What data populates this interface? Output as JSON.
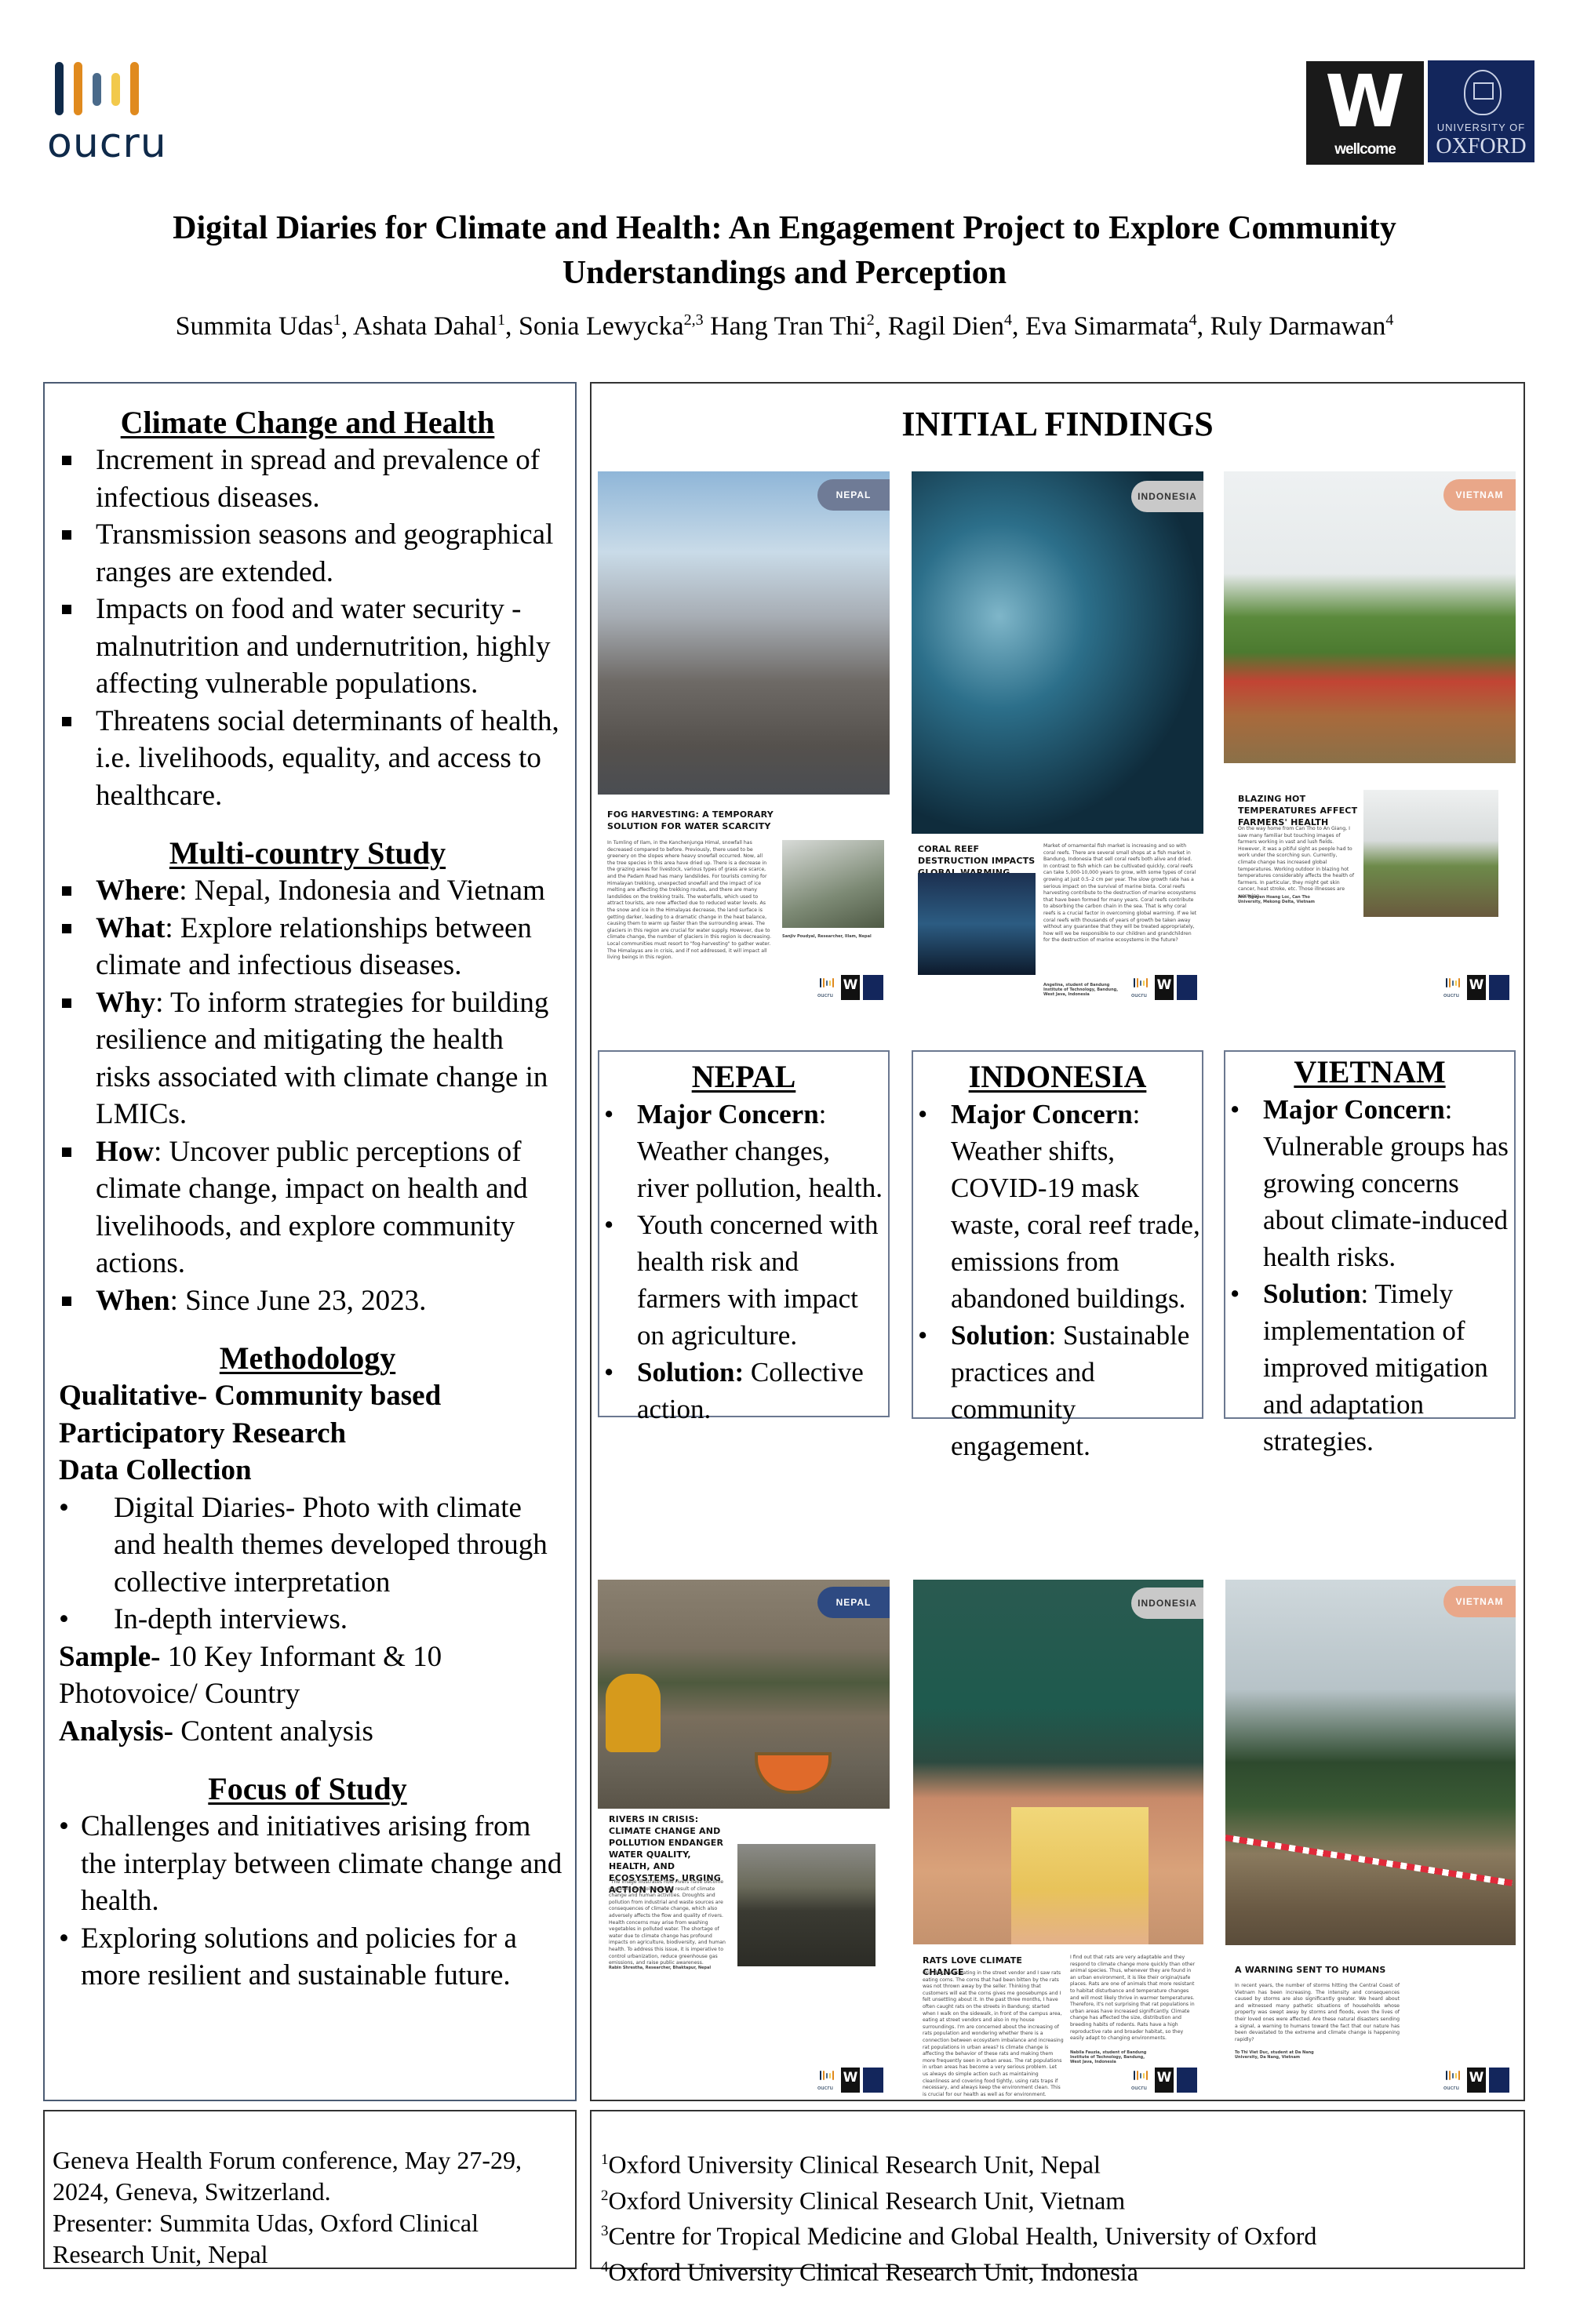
{
  "header": {
    "logos": {
      "oucru": {
        "text": "oucru",
        "bar_colors": [
          "#0f2a4a",
          "#e08a1e",
          "#4a6a8a",
          "#f2c94c",
          "#e08a1e"
        ]
      },
      "wellcome": {
        "mark": "W",
        "text": "wellcome",
        "bg": "#1a1a1a"
      },
      "oxford": {
        "small_text": "UNIVERSITY OF",
        "big_text": "OXFORD",
        "bg": "#13265c"
      }
    },
    "title_line1": "Digital Diaries for Climate and Health: An Engagement Project to Explore Community",
    "title_line2": "Understandings and Perception",
    "authors": [
      {
        "name": "Summita Udas",
        "sup": "1",
        "sep": ", "
      },
      {
        "name": "Ashata Dahal",
        "sup": "1",
        "sep": ", "
      },
      {
        "name": "Sonia Lewycka",
        "sup": "2,3",
        "sep": " "
      },
      {
        "name": "Hang Tran Thi",
        "sup": "2",
        "sep": ", "
      },
      {
        "name": "Ragil Dien",
        "sup": "4",
        "sep": ", "
      },
      {
        "name": "Eva Simarmata",
        "sup": "4",
        "sep": ", "
      },
      {
        "name": "Ruly Darmawan",
        "sup": "4",
        "sep": ""
      }
    ]
  },
  "left_panel": {
    "climate_health": {
      "title": "Climate Change and Health",
      "items": [
        "Increment in spread and prevalence of infectious diseases.",
        "Transmission seasons and geographical ranges are extended.",
        "Impacts on food and water security - malnutrition and undernutrition, highly affecting vulnerable populations.",
        "Threatens social determinants of health, i.e. livelihoods, equality, and access to healthcare."
      ]
    },
    "multi_country": {
      "title": "Multi-country Study",
      "items": [
        {
          "label": "Where",
          "text": ": Nepal, Indonesia and Vietnam"
        },
        {
          "label": "What",
          "text": ": Explore relationships between climate and infectious diseases."
        },
        {
          "label": "Why",
          "text": ": To inform strategies for building resilience and mitigating the health risks associated with climate change in LMICs."
        },
        {
          "label": "How",
          "text": ": Uncover public perceptions of climate change, impact on health and livelihoods, and explore community actions."
        },
        {
          "label": "When",
          "text": ": Since June 23, 2023."
        }
      ]
    },
    "methodology": {
      "title": "Methodology",
      "approach": "Qualitative- Community based Participatory Research",
      "data_collection_label": "Data Collection",
      "data_collection": [
        "Digital Diaries- Photo with climate and health themes developed through collective interpretation",
        "In-depth interviews."
      ],
      "sample_label": "Sample-",
      "sample_text": " 10 Key Informant & 10 Photovoice/ Country",
      "analysis_label": "Analysis-",
      "analysis_text": " Content analysis"
    },
    "focus": {
      "title": "Focus of Study",
      "items": [
        "Challenges and initiatives arising from the interplay between climate change and health.",
        "Exploring solutions and policies for a more resilient and sustainable future."
      ]
    }
  },
  "right_panel": {
    "title": "INITIAL FINDINGS",
    "tag_colors": {
      "nepal": "#6f7b96",
      "indonesia": "#c9c9c9",
      "vietnam": "#e9a789",
      "nepal_dark": "#2e4a82"
    },
    "top_cards": [
      {
        "country": "NEPAL",
        "heading": "Fog Harvesting: A Temporary Solution for Water Scarcity",
        "body": "In Tumling of Ilam, in the Kanchenjunga Himal, snowfall has decreased compared to before. Previously, there used to be greenery on the slopes where heavy snowfall occurred. Now, all the tree species in this area have dried up. There is a decrease in the grazing areas for livestock, various types of grass are scarce, and the Padam Road has many landslides. For tourists coming for Himalayan trekking, unexpected snowfall and the impact of ice melting are affecting the trekking routes, and there are many landslides on the trekking trails. The waterfalls, which used to attract tourists, are now affected due to reduced water levels. As the snow and ice in the Himalayas decrease, the land surface is getting darker, leading to a dramatic change in the heat balance, causing them to warm up faster than the surrounding areas. The glaciers in this region are crucial for water supply. However, due to climate change, the number of glaciers in this region is decreasing. Local communities must resort to \"fog-harvesting\" to gather water. The Himalayas are in crisis, and if not addressed, it will impact all living beings in this region.",
        "credit": "Sanjiv Poudyal, Researcher, Illam, Nepal"
      },
      {
        "country": "INDONESIA",
        "heading": "Coral Reef Destruction Impacts Global Warming",
        "body": "Market of ornamental fish market is increasing and so with coral reefs. There are several small shops at a fish market in Bandung, Indonesia that sell coral reefs both alive and dried. In contrast to fish which can be cultivated quickly, coral reefs can take 5,000-10,000 years to grow, with some types of coral growing at just 0.5–2 cm per year. The slow growth rate has a serious impact on the survival of marine biota. Coral reefs harvesting contribute to the destruction of marine ecosystems that have been formed for many years. Coral reefs contribute to absorbing the carbon chain in the sea. That is why coral reefs is a crucial factor in overcoming global warming. If we let coral reefs with thousands of years of growth be taken away without any guarantee that they will be treated appropriately, how will we be responsible to our children and grandchildren for the destruction of marine ecosystems in the future?",
        "credit": "Angelina, student of Bandung Institute of Technology, Bandung, West Java, Indonesia"
      },
      {
        "country": "VIETNAM",
        "heading": "Blazing Hot Temperatures Affect Farmers' Health",
        "body": "On the way home from Can Tho to An Giang, I saw many familiar but touching images of farmers working in vast and lush fields. However, it was a pitiful sight as people had to work under the scorching sun. Currently, climate change has increased global temperatures. Working outdoor in blazing hot temperatures considerably affects the health of farmers. In particular, they might get skin cancer, heat stroke, etc. Those illnesses are worrying.",
        "credit": "Anh Nguyen Hoang Loc, Can Tho University, Mekong Delta, Vietnam"
      }
    ],
    "country_findings": [
      {
        "title": "NEPAL",
        "items": [
          {
            "label": "Major Concern",
            "suffix": ":",
            "text": " Weather changes, river pollution, health."
          },
          {
            "label": "",
            "suffix": "",
            "text": "Youth concerned with health risk and farmers with impact on agriculture."
          },
          {
            "label": "Solution:",
            "suffix": "",
            "text": " Collective action."
          }
        ]
      },
      {
        "title": "INDONESIA",
        "items": [
          {
            "label": "Major Concern",
            "suffix": ":",
            "text": " Weather shifts, COVID-19 mask waste, coral reef trade, emissions from abandoned buildings."
          },
          {
            "label": "Solution",
            "suffix": ":",
            "text": " Sustainable practices and community engagement."
          }
        ]
      },
      {
        "title": "VIETNAM",
        "items": [
          {
            "label": "Major Concern",
            "suffix": ":",
            "text": " Vulnerable groups has growing concerns about climate-induced health risks."
          },
          {
            "label": "Solution",
            "suffix": ":",
            "text": " Timely implementation of improved mitigation and adaptation strategies."
          }
        ]
      }
    ],
    "bottom_cards": [
      {
        "country": "NEPAL",
        "heading": "Rivers in Crisis: Climate Change and Pollution Endanger Water Quality, Health, and Ecosystems, Urging Action Now",
        "body": "\"The image illustrates how rivers have become depleted and polluted as a result of climate change and human activities. Droughts and pollution from industrial and waste sources are consequences of climate change, which also adversely affects the flow and quality of rivers. Health concerns may arise from washing vegetables in polluted water. The shortage of water due to climate change has profound impacts on agriculture, biodiversity, and human health. To address this issue, it is imperative to control urbanization, reduce greenhouse gas emissions, and raise public awareness.",
        "credit": "Rabin Shrestha, Researcher, Bhaktapur, Nepal"
      },
      {
        "country": "INDONESIA",
        "heading": "Rats Love Climate Change",
        "body": "One day, I was eating in the street vendor and I saw rats eating corns. The corns that had been bitten by the rats was not thrown away by the seller. Thinking that customers will eat the corns gives me goosebumps and I felt unsettling about it. In the past three months, I have often caught rats on the streets in Bandung; started when I walk on the sidewalk, in front of the campus area, eating at street vendors and also in my house surroundings. I'm are concerned about the increasing of rats population and wondering whether there is a connection between ecosystem imbalance and increasing rat populations in urban areas? Is climate change is affecting the behavior of these rats and making them more frequently seen in urban areas. The rat populations in urban areas has become a very serious problem. Let us always do simple action such as maintaining cleanliness and covering food tightly, using rats traps if necessary, and always keep the environment clean. This is crucial for our health as well as for environment.",
        "body2": "I find out that rats are very adaptable and they respond to climate change more quickly than other animal species. Thus, whenever they are found in an urban environment, it is like their original/safe places. Rats are one of animals that more resistant to habitat disturbance and temperature changes and will most likely thrive in warmer temperatures. Therefore, it's not surprising that rat populations in urban areas have increased significantly. Climate change has affected the size, distribution and breeding habits of rodents. Rats have a high reproductive rate and broader habitat, so they easily adapt to changing environments.",
        "credit": "Nabila Fauzia, student of Bandung Institute of Technology, Bandung, West Java, Indonesia"
      },
      {
        "country": "VIETNAM",
        "heading": "A Warning Sent to Humans",
        "body": "In recent years, the number of storms hitting the Central Coast of Vietnam has been increasing. The intensity and consequences caused by storms are also significantly greater. We heard about and witnessed many pathetic situations of households whose property was swept away by storms and floods, even the lives of their loved ones were affected. Are these natural disasters sending a signal, a warning to humans toward the fact that our nature has been devastated to the extreme and climate change is happening rapidly?",
        "credit": "To Thi Viet Duc, student at Da Nang University, Da Nang, Vietnam"
      }
    ]
  },
  "footer": {
    "conference": [
      "Geneva Health Forum conference, May 27-29,",
      "2024, Geneva,  Switzerland.",
      "Presenter: Summita Udas, Oxford Clinical",
      "Research Unit, Nepal"
    ],
    "affiliations": [
      {
        "sup": "1",
        "text": "Oxford University Clinical Research Unit, Nepal"
      },
      {
        "sup": "2",
        "text": "Oxford University Clinical Research Unit, Vietnam"
      },
      {
        "sup": "3",
        "text": "Centre for Tropical Medicine and Global Health, University of Oxford"
      },
      {
        "sup": "4",
        "text": "Oxford University Clinical Research Unit, Indonesia"
      }
    ]
  }
}
